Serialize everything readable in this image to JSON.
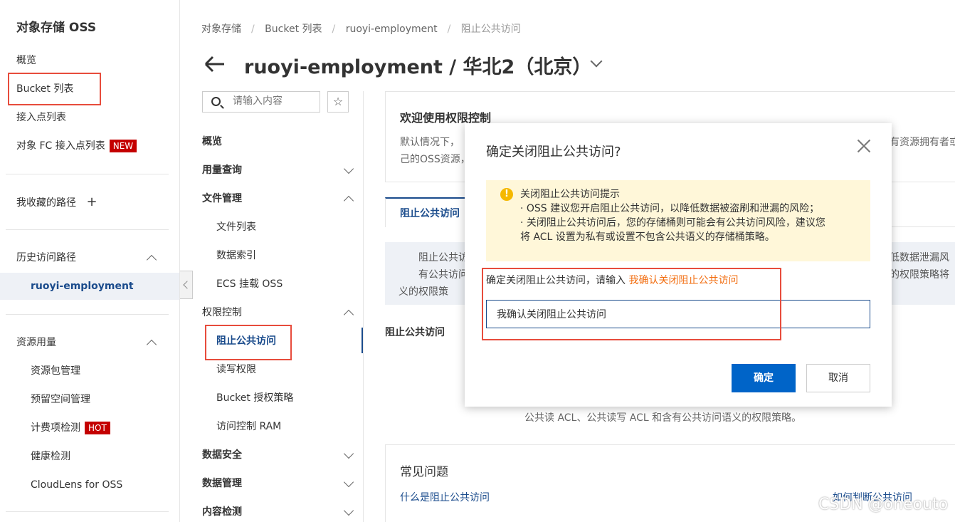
{
  "sidebar": {
    "title": "对象存储 OSS",
    "items": [
      {
        "label": "概览"
      },
      {
        "label": "Bucket 列表"
      },
      {
        "label": "接入点列表"
      },
      {
        "label": "对象 FC 接入点列表",
        "badge": "NEW"
      }
    ],
    "favorites_label": "我收藏的路径",
    "favorites_add": "+",
    "history_label": "历史访问路径",
    "history_items": [
      {
        "label": "ruoyi-employment"
      }
    ],
    "resources_label": "资源用量",
    "resource_items": [
      {
        "label": "资源包管理"
      },
      {
        "label": "预留空间管理"
      },
      {
        "label": "计费项检测",
        "badge": "HOT"
      },
      {
        "label": "健康检测"
      },
      {
        "label": "CloudLens for OSS"
      }
    ]
  },
  "breadcrumb": [
    "对象存储",
    "Bucket 列表",
    "ruoyi-employment",
    "阻止公共访问"
  ],
  "header": {
    "title": "ruoyi-employment / 华北2（北京）"
  },
  "secondary_nav": {
    "search_placeholder": "请输入内容",
    "star": "☆",
    "items": [
      {
        "label": "概览"
      },
      {
        "label": "用量查询"
      },
      {
        "label": "文件管理"
      },
      {
        "label": "文件列表"
      },
      {
        "label": "数据索引"
      },
      {
        "label": "ECS 挂载 OSS"
      },
      {
        "label": "权限控制"
      },
      {
        "label": "阻止公共访问"
      },
      {
        "label": "读写权限"
      },
      {
        "label": "Bucket 授权策略"
      },
      {
        "label": "访问控制 RAM"
      },
      {
        "label": "数据安全"
      },
      {
        "label": "数据管理"
      },
      {
        "label": "内容检测"
      }
    ]
  },
  "main": {
    "welcome_title": "欢迎使用权限控制",
    "welcome_line1": "默认情况下，",
    "welcome_line1_right": "有资源拥有者或",
    "welcome_line2": "己的OSS资源，",
    "tab_active": "阻止公共访问",
    "info_left": [
      "阻止公共访",
      "有公共访问",
      "义的权限策"
    ],
    "info_right": [
      "低数据泄漏风",
      "的权限策略将"
    ],
    "section_label": "阻止公共访问",
    "bottom_line": "公共读 ACL、公共读写 ACL 和含有公共访问语义的权限策略。",
    "faq_title": "常见问题",
    "faq_links": [
      "什么是阻止公共访问",
      "如何判断公共访问"
    ]
  },
  "modal": {
    "title": "确定关闭阻止公共访问?",
    "warn_icon": "!",
    "warn_lines": [
      "关闭阻止公共访问提示",
      "· OSS 建议您开启阻止公共访问，以降低数据被盗刷和泄漏的风险；",
      "· 关闭阻止公共访问后，您的存储桶则可能会有公共访问风险，建议您",
      "将 ACL 设置为私有或设置不包含公共语义的存储桶策略。"
    ],
    "confirm_prompt": "确定关闭阻止公共访问，请输入",
    "confirm_phrase": "我确认关闭阻止公共访问",
    "input_value": "我确认关闭阻止公共访问",
    "ok_label": "确定",
    "cancel_label": "取消"
  },
  "watermark": "CSDN @oneouto"
}
